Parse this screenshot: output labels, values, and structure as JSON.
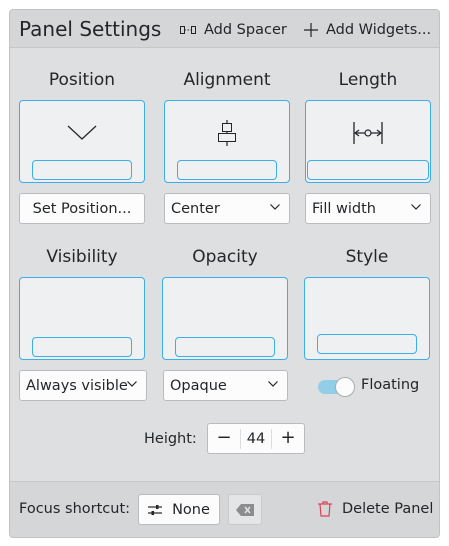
{
  "header": {
    "title": "Panel Settings",
    "add_spacer": "Add Spacer",
    "add_widgets": "Add Widgets..."
  },
  "sections": {
    "position": {
      "label": "Position",
      "button": "Set Position..."
    },
    "alignment": {
      "label": "Alignment",
      "value": "Center"
    },
    "length": {
      "label": "Length",
      "value": "Fill width"
    },
    "visibility": {
      "label": "Visibility",
      "value": "Always visible"
    },
    "opacity": {
      "label": "Opacity",
      "value": "Opaque"
    },
    "style": {
      "label": "Style",
      "toggle_label": "Floating",
      "floating": true
    }
  },
  "height": {
    "label": "Height:",
    "value": "44",
    "minus": "−",
    "plus": "+"
  },
  "footer": {
    "focus_label": "Focus shortcut:",
    "shortcut_value": "None",
    "delete_label": "Delete Panel"
  },
  "colors": {
    "accent": "#3daee9",
    "delete": "#da4453"
  }
}
